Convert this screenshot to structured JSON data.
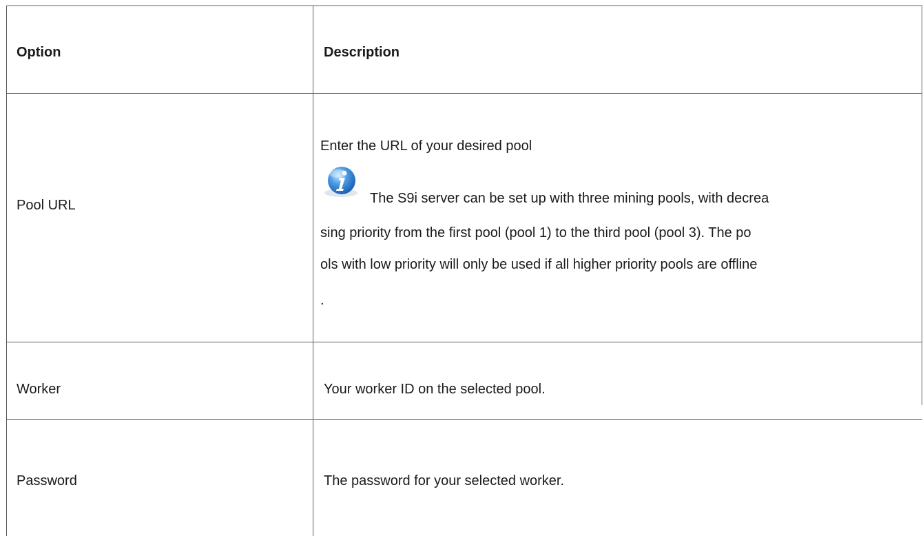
{
  "table": {
    "headers": {
      "option": "Option",
      "description": "Description"
    },
    "rows": [
      {
        "option": "Pool URL",
        "description_intro": "Enter the URL of your desired pool",
        "note_lines": [
          "The S9i server can be set up with three mining pools, with decrea",
          "sing priority from the first pool (pool 1) to the third pool (pool 3). The po",
          "ols with low priority will only be used if all higher priority pools are offline",
          "."
        ],
        "note_icon": "info-icon"
      },
      {
        "option": "Worker",
        "description": "Your worker ID on the selected pool."
      },
      {
        "option": "Password",
        "description": "The password for your selected worker."
      }
    ]
  },
  "colors": {
    "border": "#5a5a5a",
    "text": "#1a1a1a",
    "icon_blue": "#2f7fd1"
  }
}
